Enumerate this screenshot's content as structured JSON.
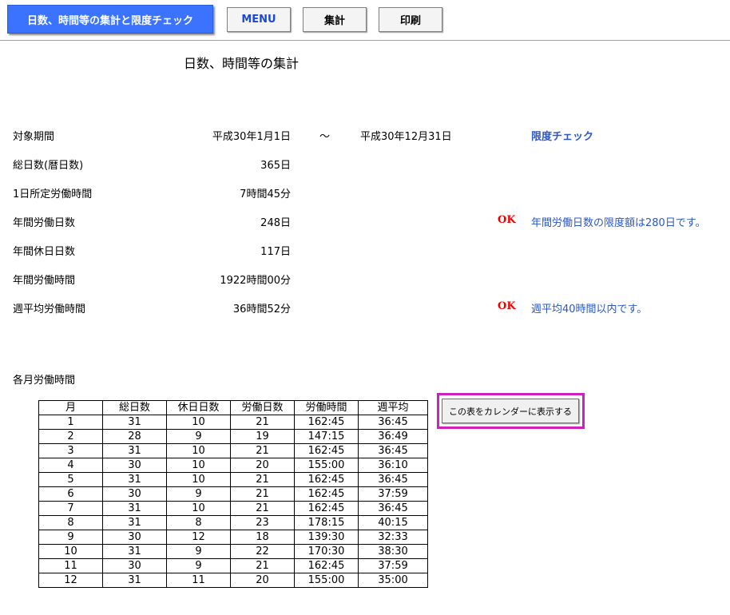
{
  "toolbar": {
    "title": "日数、時間等の集計と限度チェック",
    "menu_label": "MENU",
    "total_label": "集計",
    "print_label": "印刷"
  },
  "page_title": "日数、時間等の集計",
  "summary": {
    "period_label": "対象期間",
    "period_start": "平成30年1月1日",
    "tilde": "～",
    "period_end": "平成30年12月31日",
    "check_heading": "限度チェック",
    "total_days_label": "総日数(暦日数)",
    "total_days_value": "365日",
    "daily_hours_label": "1日所定労働時間",
    "daily_hours_value": "7時間45分",
    "annual_work_days_label": "年間労働日数",
    "annual_work_days_value": "248日",
    "annual_work_days_status": "OK",
    "annual_work_days_msg": "年間労働日数の限度額は280日です。",
    "annual_holidays_label": "年間休日日数",
    "annual_holidays_value": "117日",
    "annual_hours_label": "年間労働時間",
    "annual_hours_value": "1922時間00分",
    "weekly_avg_label": "週平均労働時間",
    "weekly_avg_value": "36時間52分",
    "weekly_avg_status": "OK",
    "weekly_avg_msg": "週平均40時間以内です。"
  },
  "monthly": {
    "label": "各月労働時間",
    "headers": [
      "月",
      "総日数",
      "休日日数",
      "労働日数",
      "労働時間",
      "週平均"
    ],
    "rows": [
      [
        "1",
        "31",
        "10",
        "21",
        "162:45",
        "36:45"
      ],
      [
        "2",
        "28",
        "9",
        "19",
        "147:15",
        "36:49"
      ],
      [
        "3",
        "31",
        "10",
        "21",
        "162:45",
        "36:45"
      ],
      [
        "4",
        "30",
        "10",
        "20",
        "155:00",
        "36:10"
      ],
      [
        "5",
        "31",
        "10",
        "21",
        "162:45",
        "36:45"
      ],
      [
        "6",
        "30",
        "9",
        "21",
        "162:45",
        "37:59"
      ],
      [
        "7",
        "31",
        "10",
        "21",
        "162:45",
        "36:45"
      ],
      [
        "8",
        "31",
        "8",
        "23",
        "178:15",
        "40:15"
      ],
      [
        "9",
        "30",
        "12",
        "18",
        "139:30",
        "32:33"
      ],
      [
        "10",
        "31",
        "9",
        "22",
        "170:30",
        "38:30"
      ],
      [
        "11",
        "30",
        "9",
        "21",
        "162:45",
        "37:59"
      ],
      [
        "12",
        "31",
        "11",
        "20",
        "155:00",
        "35:00"
      ]
    ],
    "calendar_button": "この表をカレンダーに表示する"
  },
  "colors": {
    "title_bg": "#3b73ff",
    "link_blue": "#2b57c7",
    "ok_red": "#ee0000",
    "highlight_magenta": "#d020c0"
  }
}
